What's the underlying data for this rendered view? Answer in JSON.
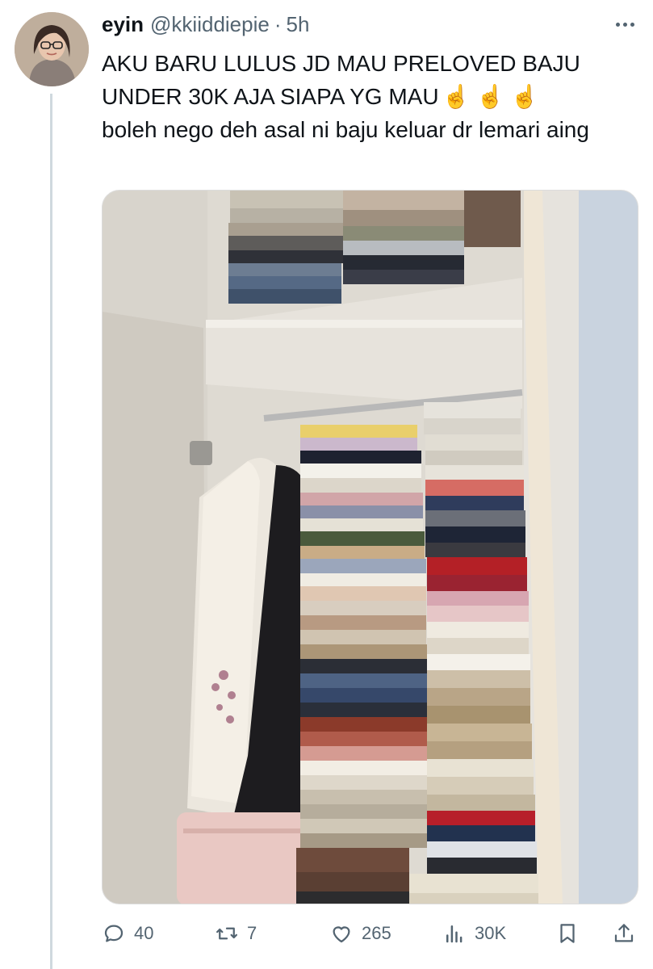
{
  "tweet": {
    "author_name": "eyin",
    "author_handle": "@kkiiddiepie",
    "separator": "·",
    "time": "5h",
    "text_line1": "AKU BARU LULUS JD MAU PRELOVED BAJU UNDER 30K AJA SIAPA YG MAU",
    "emojis": "☝️ ☝️ ☝️",
    "text_line2": "boleh nego deh asal ni baju keluar dr lemari aing"
  },
  "actions": {
    "replies": "40",
    "reposts": "7",
    "likes": "265",
    "views": "30K"
  },
  "icons": {
    "more": "more-dots-icon",
    "reply": "reply-bubble-icon",
    "repost": "repost-arrows-icon",
    "like": "heart-icon",
    "views": "views-bars-icon",
    "bookmark": "bookmark-icon",
    "share": "share-arrow-icon"
  },
  "colors": {
    "text": "#0f1419",
    "secondary": "#536471",
    "thread_line": "#cfd9de"
  }
}
